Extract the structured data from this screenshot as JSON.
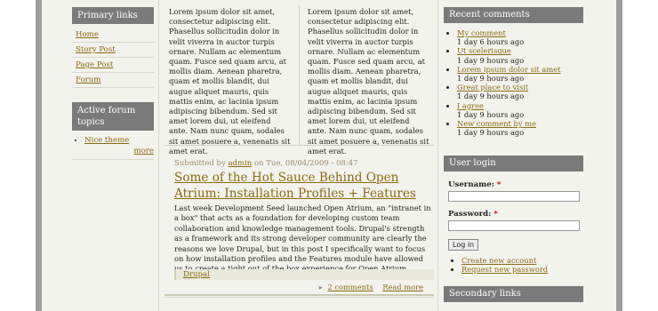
{
  "primary_links": {
    "title": "Primary links",
    "items": [
      {
        "label": "Home"
      },
      {
        "label": "Story Post"
      },
      {
        "label": "Page Post"
      },
      {
        "label": "Forum"
      }
    ]
  },
  "forum_topics": {
    "title": "Active forum topics",
    "items": [
      {
        "label": "Nice theme"
      }
    ],
    "more": "more"
  },
  "lorem": {
    "col1": "Lorem ipsum dolor sit amet, consectetur adipiscing elit. Phasellus sollicitudin dolor in velit viverra in auctor turpis ornare. Nullam ac elementum quam. Fusce sed quam arcu, at mollis diam. Aenean pharetra, quam et mollis blandit, dui augue aliquet mauris, quis mattis enim, ac lacinia ipsum adipiscing bibendum. Sed sit amet lorem dui, ut eleifend ante. Nam nunc quam, sodales sit amet posuere a, venenatis sit amet erat.",
    "col2": "Lorem ipsum dolor sit amet, consectetur adipiscing elit. Phasellus sollicitudin dolor in velit viverra in auctor turpis ornare. Nullam ac elementum quam. Fusce sed quam arcu, at mollis diam. Aenean pharetra, quam et mollis blandit, dui augue aliquet mauris, quis mattis enim, ac lacinia ipsum adipiscing bibendum. Sed sit amet lorem dui, ut eleifend ante. Nam nunc quam, sodales sit amet posuere a, venenatis sit amet erat."
  },
  "post": {
    "submitted_prefix": "Submitted by",
    "author": "admin",
    "submitted_suffix": "on Tue, 08/04/2009 - 08:47",
    "title": "Some of the Hot Sauce Behind Open Atrium: Installation Profiles + Features",
    "body": "Last week Development Seed launched Open Atrium, an \"intranet in a box\" that acts as a foundation for developing custom team collaboration and knowledge management tools. Drupal's strength as a framework and its strong developer community are clearly the reasons we love Drupal, but in this post I specifically want to focus on how installation profiles and the Features module have allowed us to create a tight out of the box experience for Open Atrium.",
    "tag": "Drupal",
    "comments_link": "2 comments",
    "read_more": "Read more"
  },
  "recent_comments": {
    "title": "Recent comments",
    "items": [
      {
        "label": "My comment",
        "time": "1 day 6 hours ago"
      },
      {
        "label": "Ut scelerisque",
        "time": "1 day 9 hours ago"
      },
      {
        "label": "Lorem ipsum dolor sit amet",
        "time": "1 day 9 hours ago"
      },
      {
        "label": "Great place to visit",
        "time": "1 day 9 hours ago"
      },
      {
        "label": "I agree",
        "time": "1 day 9 hours ago"
      },
      {
        "label": "New comment by me",
        "time": "1 day 9 hours ago"
      }
    ]
  },
  "login": {
    "title": "User login",
    "username_label": "Username:",
    "password_label": "Password:",
    "required_mark": "*",
    "button": "Log in",
    "create_account": "Create new account",
    "request_password": "Request new password"
  },
  "secondary_links": {
    "title": "Secondary links"
  },
  "colors": {
    "link": "#8a6b14",
    "block_title_bg": "#7a7a7a",
    "page_frame": "#9e9e9e",
    "content_bg": "#f3f3ee"
  }
}
